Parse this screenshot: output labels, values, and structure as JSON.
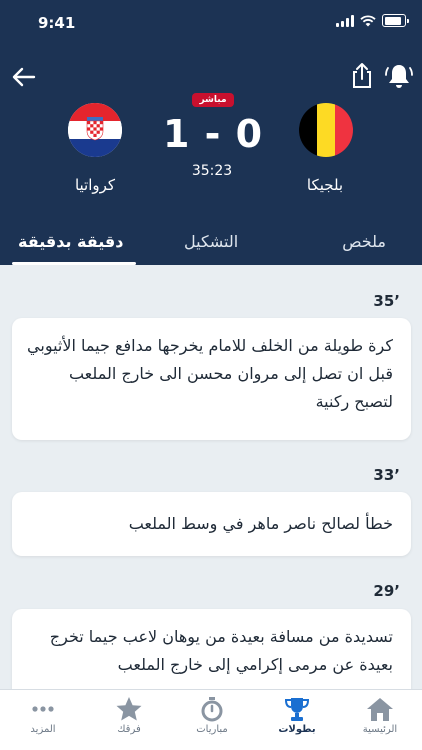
{
  "status": {
    "time": "9:41"
  },
  "match": {
    "live_label": "مباشر",
    "score": "1 - 0",
    "clock": "35:23",
    "home_team": "بلجيكا",
    "away_team": "كرواتيا"
  },
  "tabs": [
    {
      "label": "ملخص"
    },
    {
      "label": "التشكيل"
    },
    {
      "label": "دقيقة بدقيقة"
    }
  ],
  "feed": [
    {
      "minute": "35’",
      "text": "كرة طويلة من الخلف للامام يخرجها مدافع جيما الأثيوبي قبل ان تصل إلى مروان محسن الى خارج الملعب لتصبح ركنية"
    },
    {
      "minute": "33’",
      "text": "خطأ لصالح ناصر ماهر في وسط الملعب"
    },
    {
      "minute": "29’",
      "text": "تسديدة من مسافة بعيدة من يوهان لاعب جيما تخرج بعيدة عن مرمى إكرامي إلى خارج الملعب"
    }
  ],
  "tabbar": [
    {
      "label": "الرئيسية",
      "icon": "home-icon"
    },
    {
      "label": "بطولات",
      "icon": "trophy-icon",
      "active": true
    },
    {
      "label": "مباريات",
      "icon": "stopwatch-icon"
    },
    {
      "label": "فرقك",
      "icon": "star-icon"
    },
    {
      "label": "المزيد",
      "icon": "more-icon"
    }
  ],
  "colors": {
    "header": "#1c3354",
    "live": "#c8102e",
    "background": "#e9eef2"
  }
}
